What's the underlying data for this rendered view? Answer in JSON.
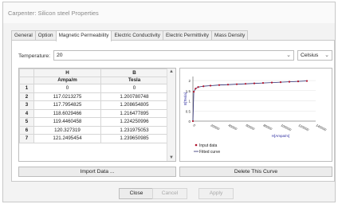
{
  "window": {
    "title": "Carpenter: Silicon steel Properties"
  },
  "tabs": [
    {
      "label": "General"
    },
    {
      "label": "Option"
    },
    {
      "label": "Magnetic Permeability",
      "active": true
    },
    {
      "label": "Electric Conductivity"
    },
    {
      "label": "Electric Permittivity"
    },
    {
      "label": "Mass Density"
    }
  ],
  "temperature": {
    "label": "Temperature:",
    "value": "20",
    "unit": "Celsius"
  },
  "grid": {
    "col_h_name": "H",
    "col_h_unit": "Ampa/m",
    "col_b_name": "B",
    "col_b_unit": "Tesla",
    "rows": [
      {
        "n": "1",
        "h": "0",
        "b": "0"
      },
      {
        "n": "2",
        "h": "117.0213275",
        "b": "1.200780748"
      },
      {
        "n": "3",
        "h": "117.7954825",
        "b": "1.208654805"
      },
      {
        "n": "4",
        "h": "118.6029466",
        "b": "1.216477895"
      },
      {
        "n": "5",
        "h": "119.4460458",
        "b": "1.224250996"
      },
      {
        "n": "6",
        "h": "120.327319",
        "b": "1.231975053"
      },
      {
        "n": "7",
        "h": "121.2495454",
        "b": "1.239650985"
      }
    ]
  },
  "chart_data": {
    "type": "line",
    "xlabel": "H[Ampa/m]",
    "ylabel": "B[Tesla]",
    "xticks": [
      "0",
      "20000",
      "40000",
      "60000",
      "80000",
      "100000",
      "120000",
      "140000"
    ],
    "yticks": [
      "0",
      "0.5",
      "1",
      "1.5",
      "2"
    ],
    "xlim": [
      0,
      140000
    ],
    "ylim": [
      0,
      2.2
    ],
    "legend": [
      "Input data",
      "Fitted curve"
    ],
    "colors": {
      "input": "#b0102a",
      "fitted": "#2b2b6f"
    },
    "input_data": [
      [
        0,
        0
      ],
      [
        1000,
        1.45
      ],
      [
        3000,
        1.6
      ],
      [
        6000,
        1.68
      ],
      [
        12000,
        1.72
      ],
      [
        20000,
        1.75
      ],
      [
        30000,
        1.78
      ],
      [
        40000,
        1.8
      ],
      [
        50000,
        1.82
      ],
      [
        60000,
        1.84
      ],
      [
        70000,
        1.86
      ],
      [
        80000,
        1.88
      ],
      [
        90000,
        1.9
      ],
      [
        100000,
        1.92
      ],
      [
        110000,
        1.94
      ],
      [
        120000,
        1.96
      ],
      [
        130000,
        1.98
      ]
    ]
  },
  "buttons": {
    "import": "Import Data ...",
    "delete": "Delete This Curve",
    "close": "Close",
    "cancel": "Cancel",
    "apply": "Apply"
  }
}
